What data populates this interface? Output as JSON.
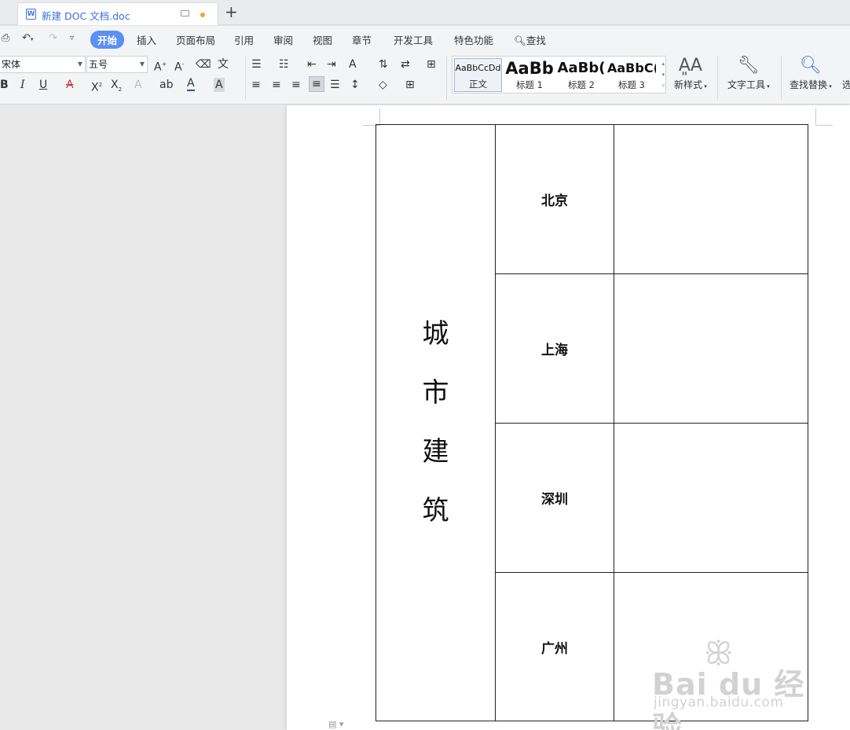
{
  "tab": {
    "title": "新建 DOC 文档.doc",
    "doc_icon": "W",
    "new_tab": "+"
  },
  "menu": {
    "items": [
      "开始",
      "插入",
      "页面布局",
      "引用",
      "审阅",
      "视图",
      "章节",
      "开发工具",
      "特色功能"
    ],
    "search_label": "查找"
  },
  "ribbon": {
    "font_name": "宋体",
    "font_size": "五号",
    "styles": [
      {
        "preview": "AaBbCcDd",
        "label": "正文"
      },
      {
        "preview": "AaBb",
        "label": "标题 1"
      },
      {
        "preview": "AaBb(",
        "label": "标题 2"
      },
      {
        "preview": "AaBbC(",
        "label": "标题 3"
      }
    ],
    "new_style": "新样式",
    "text_tools": "文字工具",
    "find_replace": "查找替换",
    "select_partial": "选"
  },
  "document": {
    "vertical_title": [
      "城",
      "市",
      "建",
      "筑"
    ],
    "cities": [
      "北京",
      "上海",
      "深圳",
      "广州"
    ]
  },
  "watermark": {
    "brand": "Bai du 经验",
    "site": "jingyan.baidu.com"
  }
}
